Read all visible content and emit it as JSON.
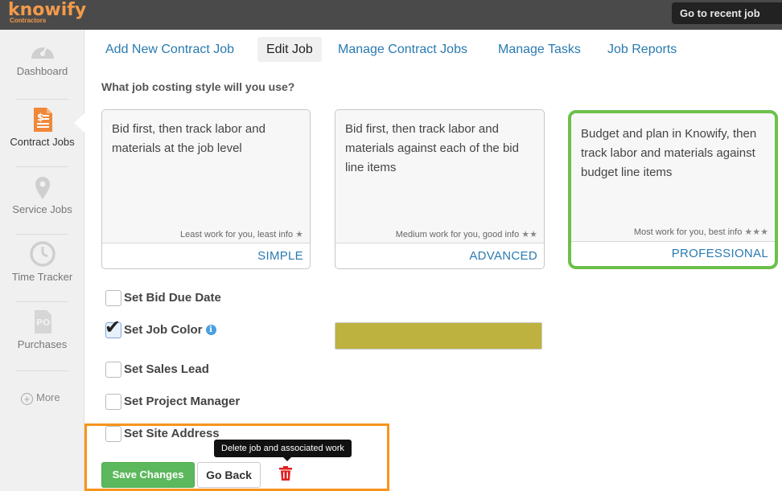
{
  "app": {
    "logo_text": "knowify",
    "logo_sub": "Contractors",
    "recent_job_button": "Go to recent job",
    "brand_color": "#f29a4a"
  },
  "sidebar": {
    "items": [
      {
        "label": "Dashboard",
        "icon": "gauge-icon"
      },
      {
        "label": "Contract Jobs",
        "icon": "document-dollar-icon"
      },
      {
        "label": "Service Jobs",
        "icon": "map-pin-icon"
      },
      {
        "label": "Time Tracker",
        "icon": "clock-icon"
      },
      {
        "label": "Purchases",
        "icon": "purchase-order-icon"
      }
    ],
    "more_label": "More",
    "active": "Contract Jobs"
  },
  "nav": {
    "tabs": [
      {
        "label": "Add New Contract Job"
      },
      {
        "label": "Edit Job"
      },
      {
        "label": "Manage Contract Jobs"
      },
      {
        "label": "Manage Tasks"
      },
      {
        "label": "Job Reports"
      }
    ],
    "active": "Edit Job"
  },
  "costing": {
    "question": "What job costing style will you use?",
    "options": [
      {
        "description": "Bid first, then track labor and materials at the job level",
        "note": "Least work for you, least info",
        "stars": "★",
        "name": "SIMPLE"
      },
      {
        "description": "Bid first, then track labor and materials against each of the bid line items",
        "note": "Medium work for you, good info",
        "stars": "★★",
        "name": "ADVANCED"
      },
      {
        "description": "Budget and plan in Knowify, then track labor and materials against budget line items",
        "note": "Most work for you, best info",
        "stars": "★★★",
        "name": "PROFESSIONAL"
      }
    ],
    "selected": "PROFESSIONAL",
    "selected_color": "#6cc04a"
  },
  "settings": {
    "bid_due_date": {
      "label": "Set Bid Due Date",
      "checked": false
    },
    "job_color": {
      "label": "Set Job Color",
      "checked": true,
      "info_icon": "i",
      "color": "#bdb23f"
    },
    "sales_lead": {
      "label": "Set Sales Lead",
      "checked": false
    },
    "project_manager": {
      "label": "Set Project Manager",
      "checked": false
    },
    "site_address": {
      "label": "Set Site Address",
      "checked": false
    }
  },
  "actions": {
    "save_label": "Save Changes",
    "back_label": "Go Back",
    "delete_tooltip": "Delete job and associated work",
    "highlight_color": "#f7941d"
  }
}
